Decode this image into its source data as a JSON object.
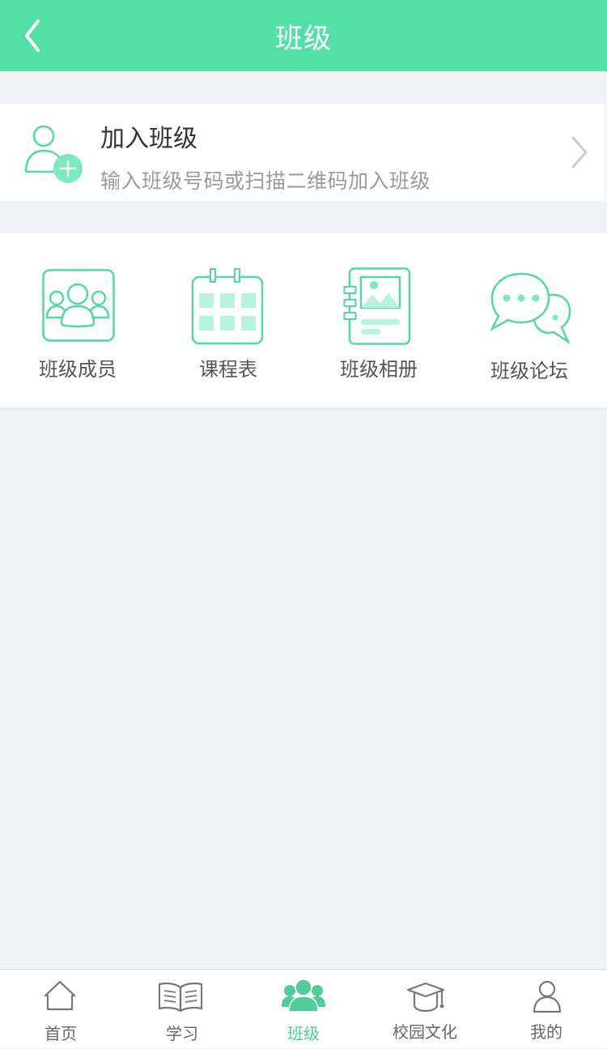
{
  "header": {
    "title": "班级"
  },
  "join": {
    "title": "加入班级",
    "subtitle": "输入班级号码或扫描二维码加入班级"
  },
  "features": [
    {
      "label": "班级成员",
      "icon": "class-members-icon"
    },
    {
      "label": "课程表",
      "icon": "timetable-icon"
    },
    {
      "label": "班级相册",
      "icon": "class-album-icon"
    },
    {
      "label": "班级论坛",
      "icon": "class-forum-icon"
    }
  ],
  "tabs": [
    {
      "label": "首页",
      "icon": "home-icon"
    },
    {
      "label": "学习",
      "icon": "book-icon"
    },
    {
      "label": "班级",
      "icon": "group-icon",
      "active": true
    },
    {
      "label": "校园文化",
      "icon": "graduation-cap-icon"
    },
    {
      "label": "我的",
      "icon": "user-icon"
    }
  ],
  "colors": {
    "accent": "#52e0a7",
    "icon_stroke": "#52d9a3",
    "icon_fill": "#b6f3dc"
  }
}
